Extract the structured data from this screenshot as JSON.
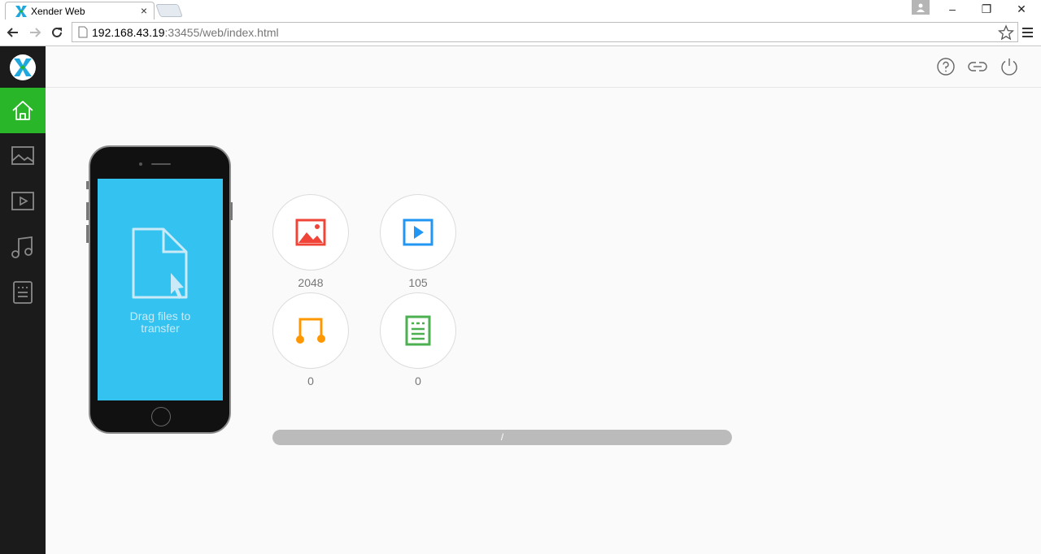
{
  "browser": {
    "tab_title": "Xender Web",
    "tab_close": "×",
    "url_host": "192.168.43.19",
    "url_rest": ":33455/web/index.html",
    "window_min": "–",
    "window_restore": "❐",
    "window_close": "✕"
  },
  "sidebar": {
    "items": [
      {
        "name": "home",
        "icon": "home-icon",
        "active": true
      },
      {
        "name": "images",
        "icon": "image-icon",
        "active": false
      },
      {
        "name": "videos",
        "icon": "video-icon",
        "active": false
      },
      {
        "name": "music",
        "icon": "music-icon",
        "active": false
      },
      {
        "name": "documents",
        "icon": "document-icon",
        "active": false
      }
    ]
  },
  "header": {
    "icons": [
      "help-icon",
      "link-icon",
      "power-icon"
    ]
  },
  "phone": {
    "drag_line1": "Drag files to",
    "drag_line2": "transfer"
  },
  "categories": {
    "images": {
      "count": "2048",
      "color": "#f04438"
    },
    "videos": {
      "count": "105",
      "color": "#2196f3"
    },
    "music": {
      "count": "0",
      "color": "#ff9800"
    },
    "documents": {
      "count": "0",
      "color": "#4caf50"
    }
  },
  "transfer": {
    "label": "/",
    "progress": 0
  },
  "colors": {
    "accent": "#29b729",
    "sidebar_bg": "#1b1b1b",
    "screen_bg": "#34c3f0"
  }
}
